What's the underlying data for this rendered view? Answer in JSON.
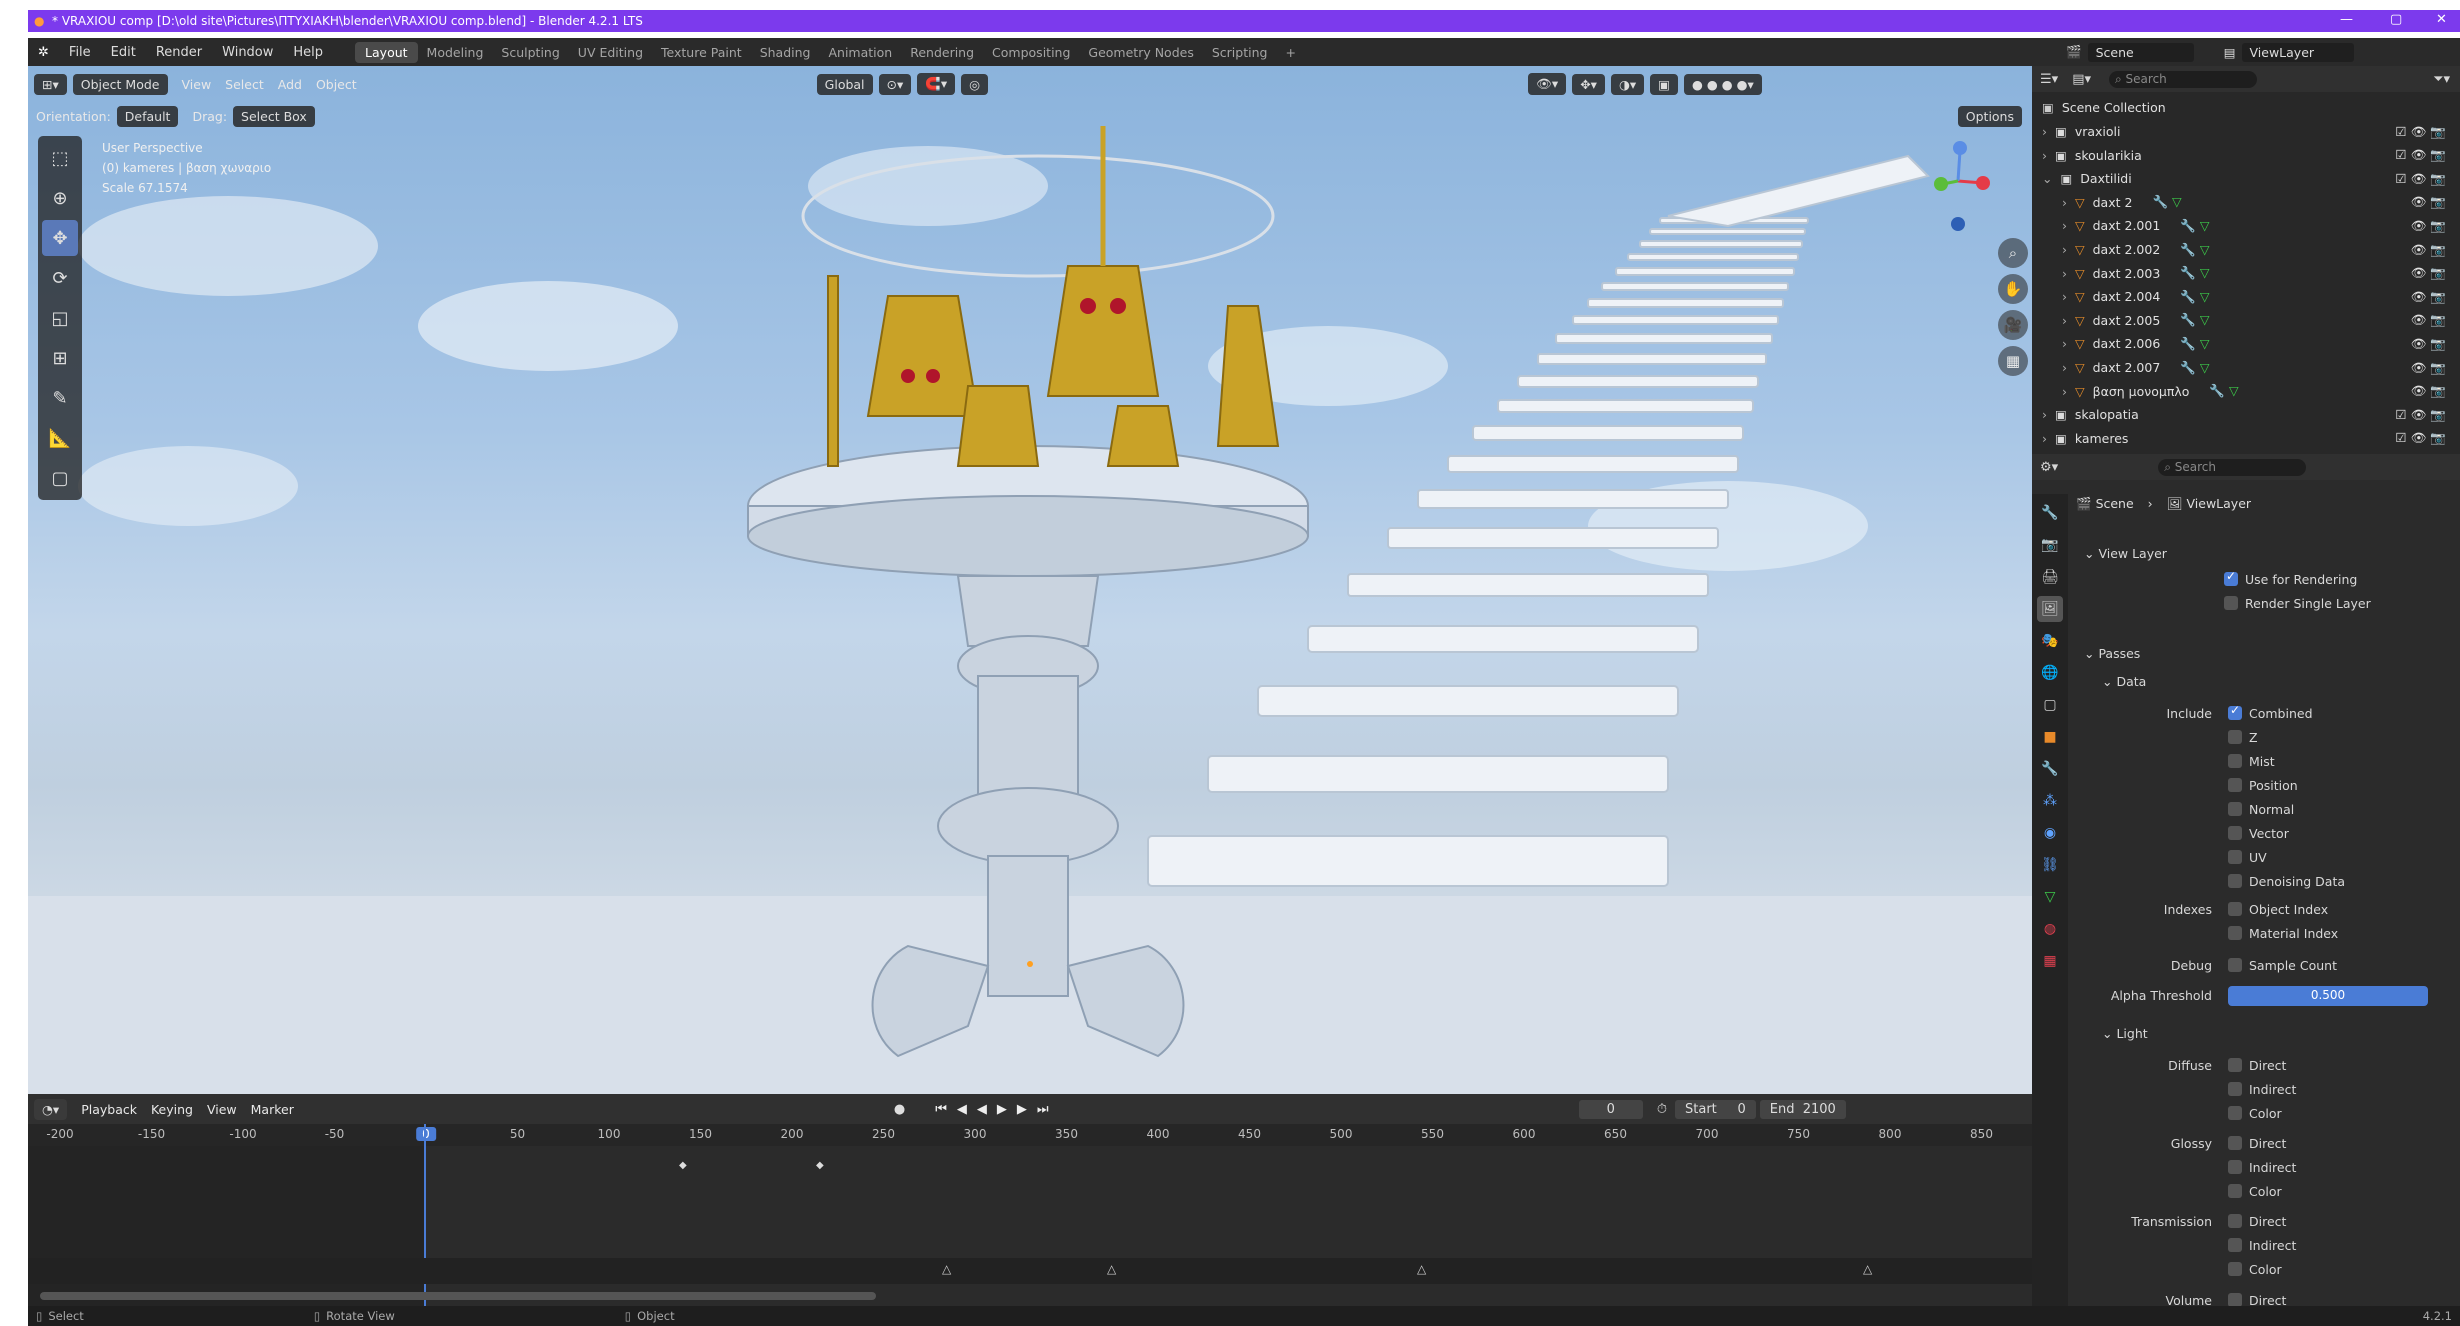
{
  "window": {
    "title": "* VRAXIOU comp [D:\\old site\\Pictures\\ΠΤΥΧΙΑΚΗ\\blender\\VRAXIOU comp.blend] - Blender 4.2.1 LTS",
    "min": "—",
    "max": "▢",
    "close": "✕"
  },
  "menu": {
    "items": [
      "File",
      "Edit",
      "Render",
      "Window",
      "Help"
    ],
    "workspaces": [
      "Layout",
      "Modeling",
      "Sculpting",
      "UV Editing",
      "Texture Paint",
      "Shading",
      "Animation",
      "Rendering",
      "Compositing",
      "Geometry Nodes",
      "Scripting"
    ],
    "add_tab": "+",
    "scene": "Scene",
    "view_layer": "ViewLayer"
  },
  "viewport": {
    "mode": "Object Mode",
    "menus": [
      "View",
      "Select",
      "Add",
      "Object"
    ],
    "transform": "Global",
    "orientation_label": "Orientation:",
    "orientation_value": "Default",
    "drag_label": "Drag:",
    "drag_value": "Select Box",
    "options": "Options",
    "info": [
      "User Perspective",
      "(0) kameres | βαση χωναριο",
      "Scale 67.1574"
    ]
  },
  "timeline": {
    "menus": [
      "Playback",
      "Keying",
      "View",
      "Marker"
    ],
    "current_frame": "0",
    "start_label": "Start",
    "start_value": "0",
    "end_label": "End",
    "end_value": "2100",
    "ruler": [
      "-200",
      "-150",
      "-100",
      "-50",
      "0",
      "50",
      "100",
      "150",
      "200",
      "250",
      "300",
      "350",
      "400",
      "450",
      "500",
      "550",
      "600",
      "650",
      "700",
      "750",
      "800",
      "850"
    ]
  },
  "status": {
    "select": "Select",
    "rotate": "Rotate View",
    "object": "Object",
    "version": "4.2.1"
  },
  "outliner": {
    "search_placeholder": "Search",
    "root": "Scene Collection",
    "rows": [
      {
        "label": "vraxioli",
        "depth": 1
      },
      {
        "label": "skoularikia",
        "depth": 1
      },
      {
        "label": "Daxtilidi",
        "depth": 1
      },
      {
        "label": "daxt 2",
        "depth": 2
      },
      {
        "label": "daxt 2.001",
        "depth": 2
      },
      {
        "label": "daxt 2.002",
        "depth": 2
      },
      {
        "label": "daxt 2.003",
        "depth": 2
      },
      {
        "label": "daxt 2.004",
        "depth": 2
      },
      {
        "label": "daxt 2.005",
        "depth": 2
      },
      {
        "label": "daxt 2.006",
        "depth": 2
      },
      {
        "label": "daxt 2.007",
        "depth": 2
      },
      {
        "label": "βαση μονομπλο",
        "depth": 2
      },
      {
        "label": "skalopatia",
        "depth": 1
      },
      {
        "label": "kameres",
        "depth": 1
      }
    ]
  },
  "properties": {
    "search_placeholder": "Search",
    "breadcrumb": [
      "Scene",
      "ViewLayer"
    ],
    "view_layer_panel": "View Layer",
    "use_for_rendering": "Use for Rendering",
    "render_single_layer": "Render Single Layer",
    "passes_panel": "Passes",
    "data_panel": "Data",
    "include_label": "Include",
    "include_items": [
      "Combined",
      "Z",
      "Mist",
      "Position",
      "Normal",
      "Vector",
      "UV",
      "Denoising Data"
    ],
    "indexes_label": "Indexes",
    "indexes_items": [
      "Object Index",
      "Material Index"
    ],
    "debug_label": "Debug",
    "debug_item": "Sample Count",
    "alpha_label": "Alpha Threshold",
    "alpha_value": "0.500",
    "light_panel": "Light",
    "diffuse_label": "Diffuse",
    "glossy_label": "Glossy",
    "transmission_label": "Transmission",
    "volume_label": "Volume",
    "light_items": [
      "Direct",
      "Indirect",
      "Color"
    ],
    "volume_item": "Direct"
  }
}
